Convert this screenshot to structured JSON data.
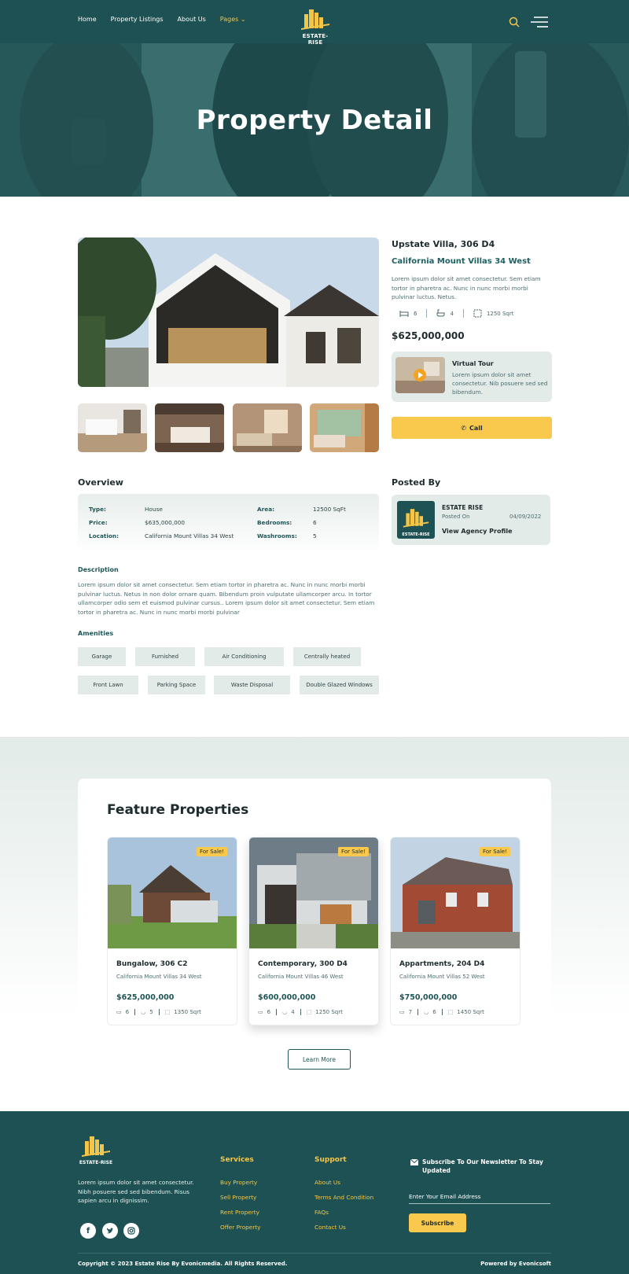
{
  "header": {
    "nav": [
      "Home",
      "Property Listings",
      "About Us"
    ],
    "pages_label": "Pages",
    "logo_text": "ESTATE-RISE"
  },
  "hero": {
    "title": "Property Detail"
  },
  "property": {
    "name": "Upstate Villa, 306 D4",
    "address": "California Mount Villas 34 West",
    "description": "Lorem ipsum dolor sit amet consectetur. Sem etiam tortor in pharetra ac. Nunc in nunc morbi morbi pulvinar luctus. Netus.",
    "beds": "6",
    "baths": "4",
    "area": "1250 Sqrt",
    "price": "$625,000,000"
  },
  "tour": {
    "title": "Virtual Tour",
    "text": "Lorem ipsum dolor sit amet consectetur. Nib posuere sed sed bibendum."
  },
  "call_label": "Call",
  "overview": {
    "heading": "Overview",
    "type_k": "Type:",
    "type_v": "House",
    "price_k": "Price:",
    "price_v": "$635,000,000",
    "location_k": "Location:",
    "location_v": "California Mount Villas 34 West",
    "area_k": "Area:",
    "area_v": "12500 SqFt",
    "bed_k": "Bedrooms:",
    "bed_v": "6",
    "wash_k": "Washrooms:",
    "wash_v": "5"
  },
  "description": {
    "heading": "Description",
    "text": "Lorem ipsum dolor sit amet consectetur. Sem etiam tortor in pharetra ac. Nunc in nunc morbi morbi pulvinar luctus. Netus in non dolor ornare quam. Bibendum proin vulputate ullamcorper arcu. In tortor ullamcorper odio sem et euismod pulvinar cursus.. Lorem ipsum dolor sit amet consectetur. Sem etiam tortor in pharetra ac. Nunc in nunc morbi morbi pulvinar"
  },
  "amenities": {
    "heading": "Amenities",
    "items": [
      "Garage",
      "Furnished",
      "Air Conditioning",
      "Centrally heated",
      "Front Lawn",
      "Parking Space",
      "Waste Disposal",
      "Double Glazed Windows"
    ]
  },
  "posted": {
    "heading": "Posted By",
    "name": "ESTATE RISE",
    "on_label": "Posted On",
    "date": "04/09/2022",
    "link": "View Agency Profile"
  },
  "featured": {
    "heading": "Feature Properties",
    "sale_label": "For Sale!",
    "cards": [
      {
        "name": "Bungalow, 306 C2",
        "address": "California Mount Villas 34 West",
        "price": "$625,000,000",
        "beds": "6",
        "baths": "5",
        "area": "1350 Sqrt"
      },
      {
        "name": "Contemporary, 300 D4",
        "address": "California Mount Villas 46 West",
        "price": "$600,000,000",
        "beds": "6",
        "baths": "4",
        "area": "1250 Sqrt"
      },
      {
        "name": "Appartments, 204 D4",
        "address": "California Mount Villas 52 West",
        "price": "$750,000,000",
        "beds": "7",
        "baths": "6",
        "area": "1450 Sqrt"
      }
    ],
    "learn_more": "Learn More"
  },
  "footer": {
    "logo_text": "ESTATE-RISE",
    "about": "Lorem ipsum dolor sit amet consectetur. Nibh posuere sed sed bibendum. Risus sapien arcu in dignissim.",
    "services_heading": "Services",
    "services": [
      "Buy Property",
      "Sell Property",
      "Rent Property",
      "Offer Property"
    ],
    "support_heading": "Support",
    "support": [
      "About Us",
      "Terms And Condition",
      "FAQs",
      "Contact Us"
    ],
    "newsletter_heading": "Subscribe To Our Newsletter To Stay Updated",
    "email_placeholder": "Enter Your Email Address",
    "subscribe": "Subscribe",
    "copyright": "Copyright © 2023 Estate Rise By Evonicmedia. All Rights Reserved.",
    "powered": "Powered by Evonicsoft"
  },
  "colors": {
    "brand": "#1d5153",
    "accent": "#f8c94d",
    "soft": "#e3ebe8"
  }
}
